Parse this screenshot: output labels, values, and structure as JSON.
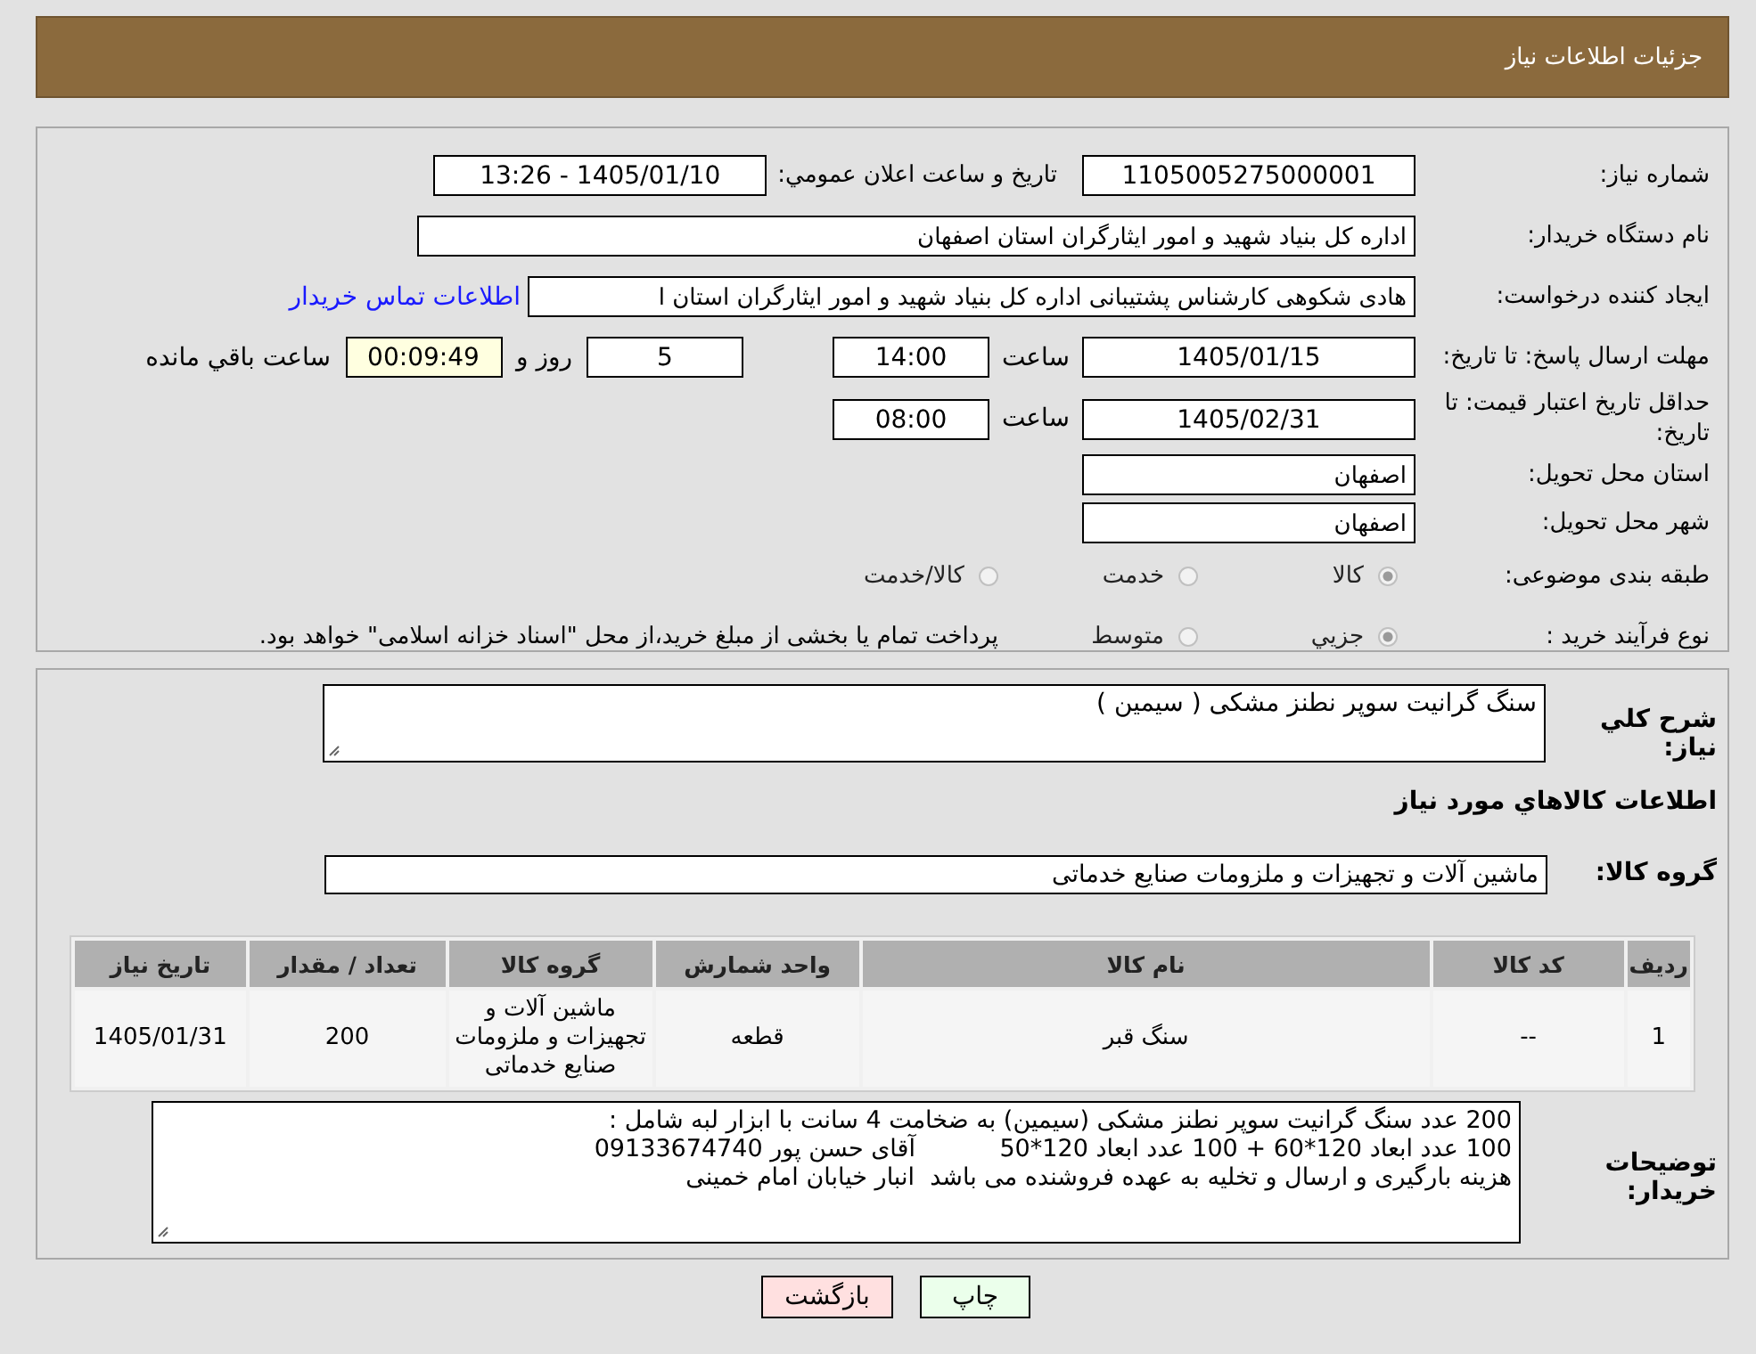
{
  "header": {
    "title": "جزئیات اطلاعات نیاز"
  },
  "form": {
    "need_number": {
      "label": "شماره نیاز:",
      "value": "1105005275000001"
    },
    "announce": {
      "label": "تاريخ و ساعت اعلان عمومي:",
      "value": "1405/01/10 - 13:26"
    },
    "buyer_org": {
      "label": "نام دستگاه خریدار:",
      "value": "اداره کل بنیاد شهید و امور ایثارگران استان اصفهان"
    },
    "creator": {
      "label": "ایجاد کننده درخواست:",
      "value": "هادی شکوهی کارشناس پشتیبانی اداره کل بنیاد شهید و امور ایثارگران استان ا",
      "link": "اطلاعات تماس خریدار"
    },
    "reply_deadline": {
      "label": "مهلت ارسال پاسخ: تا تاریخ:",
      "date": "1405/01/15",
      "time_label": "ساعت",
      "time": "14:00",
      "days": "5",
      "days_label": "روز و",
      "remaining": "00:09:49",
      "remaining_label": "ساعت باقي مانده"
    },
    "price_validity": {
      "label": "حداقل تاریخ اعتبار قیمت: تا تاریخ:",
      "date": "1405/02/31",
      "time_label": "ساعت",
      "time": "08:00"
    },
    "province": {
      "label": "استان محل تحویل:",
      "value": "اصفهان"
    },
    "city": {
      "label": "شهر محل تحویل:",
      "value": "اصفهان"
    },
    "category": {
      "label": "طبقه بندی موضوعی:",
      "options": [
        {
          "label": "کالا",
          "selected": true
        },
        {
          "label": "خدمت",
          "selected": false
        },
        {
          "label": "کالا/خدمت",
          "selected": false
        }
      ]
    },
    "purchase_type": {
      "label": "نوع فرآیند خرید :",
      "options": [
        {
          "label": "جزيي",
          "selected": true
        },
        {
          "label": "متوسط",
          "selected": false
        }
      ],
      "note": "پرداخت تمام یا بخشی از مبلغ خرید،از محل \"اسناد خزانه اسلامی\" خواهد بود."
    }
  },
  "details": {
    "summary": {
      "label": "شرح کلي نياز:",
      "value": "سنگ گرانیت سوپر نطنز مشکی ( سیمین )"
    },
    "goods_heading": "اطلاعات کالاهاي مورد نياز",
    "goods_group": {
      "label": "گروه کالا:",
      "value": "ماشین آلات و تجهیزات و ملزومات صنایع خدماتی"
    },
    "table": {
      "columns": [
        "ردیف",
        "کد کالا",
        "نام کالا",
        "واحد شمارش",
        "گروه کالا",
        "تعداد / مقدار",
        "تاریخ نیاز"
      ],
      "rows": [
        [
          "1",
          "--",
          "سنگ قبر",
          "قطعه",
          "ماشین آلات و تجهیزات و ملزومات صنایع خدماتی",
          "200",
          "1405/01/31"
        ]
      ]
    },
    "buyer_notes": {
      "label": "توضیحات خریدار:",
      "value": "200 عدد سنگ گرانیت سوپر نطنز مشکی (سیمین) به ضخامت 4 سانت با ابزار لبه شامل :\n100 عدد ابعاد 120*60 + 100 عدد ابعاد 120*50           آقای حسن پور 09133674740\nهزینه بارگیری و ارسال و تخلیه به عهده فروشنده می باشد  انبار خیابان امام خمینی"
    }
  },
  "buttons": [
    {
      "kind": "print",
      "label": "چاپ"
    },
    {
      "kind": "back",
      "label": "بازگشت"
    }
  ]
}
